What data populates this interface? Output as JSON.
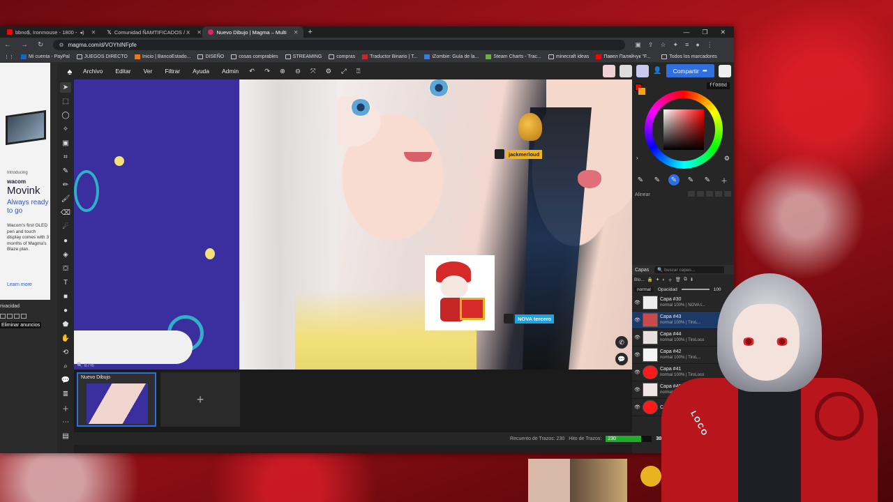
{
  "browser": {
    "tabs": [
      {
        "title": "bbno$, Ironmouse - 1800 -",
        "color": "#ff0000",
        "active": false
      },
      {
        "title": "Comunidad ÑAMTIFICADOS / X",
        "color": "#ffffff",
        "active": false
      },
      {
        "title": "Nuevo Dibujo | Magma – Multi",
        "color": "#e0245e",
        "active": true
      }
    ],
    "new_tab": "+",
    "url": "magma.com/d/VOYhINFpfe",
    "bookmarks": [
      {
        "label": "Mi cuenta - PayPal",
        "icon": "paypal-icon"
      },
      {
        "label": "JUEGOS DIRECTO",
        "icon": "folder-icon"
      },
      {
        "label": "Inicio | BancoEstado...",
        "icon": "bank-icon"
      },
      {
        "label": "DISEÑO",
        "icon": "folder-icon"
      },
      {
        "label": "cosas comprables",
        "icon": "folder-icon"
      },
      {
        "label": "STREAMING",
        "icon": "folder-icon"
      },
      {
        "label": "compras",
        "icon": "folder-icon"
      },
      {
        "label": "Traductor Binario | T...",
        "icon": "translate-icon"
      },
      {
        "label": "iZombie: Guía de la...",
        "icon": "page-icon"
      },
      {
        "label": "Steam Charts - Trac...",
        "icon": "chart-icon"
      },
      {
        "label": "minecraft ideas",
        "icon": "folder-icon"
      },
      {
        "label": "Павел Паляйчук \"F...",
        "icon": "youtube-icon"
      }
    ],
    "all_bookmarks": "Todos los marcadores"
  },
  "ad": {
    "introducing": "Introducing",
    "brand": "wacom",
    "product": "Movink",
    "tagline": "Always ready to go",
    "body": "Wacom's first OLED pen and touch display comes with 3 months of Magma's Blaze plan.",
    "learn_more": "Learn more"
  },
  "privacy": {
    "label": "rivacidad",
    "remove_ads": "Eliminar anuncios"
  },
  "magma": {
    "menu": [
      "Archivo",
      "Editar",
      "Ver",
      "Filtrar",
      "Ayuda",
      "Admin"
    ],
    "share": "Compartir",
    "hex": "ff000d",
    "align_label": "Alinear",
    "layers_label": "Capas",
    "layers_search": "buscar capas...",
    "layers_blend_prefix": "Blo...",
    "blend_mode": "normal",
    "opacity_label": "Opacidad",
    "opacity_value": "100",
    "zoom": "87%",
    "cursors": [
      {
        "name": "jackmerloud",
        "color": "#f2b31c"
      },
      {
        "name": "NOVA tercero",
        "color": "#1fa2e0"
      }
    ],
    "layers": [
      {
        "name": "Capa #30",
        "meta": "normal 100% | NOVA t...",
        "selected": false
      },
      {
        "name": "Capa #43",
        "meta": "normal 100% | TiroL...",
        "selected": true
      },
      {
        "name": "Capa #44",
        "meta": "normal 100% | TiroLoco",
        "selected": false
      },
      {
        "name": "Capa #42",
        "meta": "normal 100% | TiroL...",
        "selected": false
      },
      {
        "name": "Capa #41",
        "meta": "normal 100% | TiroLoco",
        "selected": false
      },
      {
        "name": "Capa #40",
        "meta": "normal 100%",
        "selected": false
      },
      {
        "name": "C...",
        "meta": "",
        "selected": false
      }
    ],
    "document": {
      "title": "Nuevo Dibujo",
      "add": "+"
    },
    "status": {
      "stroke_count_label": "Recuento de Trazos: 230",
      "stroke_goal_label": "Hito de Trazos:",
      "stroke_progress": "230",
      "stroke_progress_fraction": 0.77,
      "stroke_goal": "300"
    }
  },
  "vtuber": {
    "jacket_text": "LOCO"
  }
}
